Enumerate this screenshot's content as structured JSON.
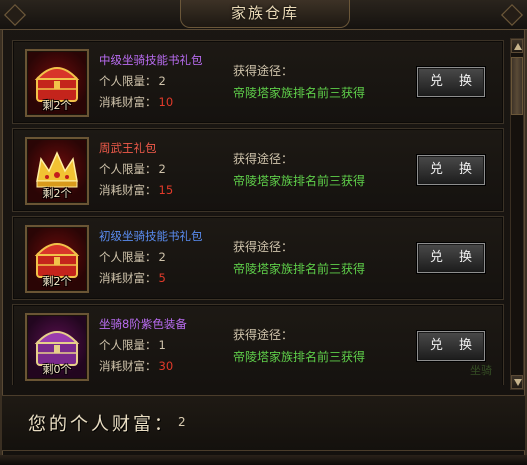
{
  "window": {
    "title": "家族仓库"
  },
  "labels": {
    "limit": "个人限量：",
    "cost": "消耗财富：",
    "source": "获得途径：",
    "exchange": "兑 换"
  },
  "items": [
    {
      "name": "中级坐骑技能书礼包",
      "name_color": "#b86cf0",
      "limit": "2",
      "cost": "10",
      "source": "帝陵塔家族排名前三获得",
      "remaining": "剩2个",
      "icon": "red-treasure-chest-icon"
    },
    {
      "name": "周武王礼包",
      "name_color": "#f05a4a",
      "limit": "2",
      "cost": "15",
      "source": "帝陵塔家族排名前三获得",
      "remaining": "剩2个",
      "icon": "golden-crown-icon"
    },
    {
      "name": "初级坐骑技能书礼包",
      "name_color": "#5a8cf0",
      "limit": "2",
      "cost": "5",
      "source": "帝陵塔家族排名前三获得",
      "remaining": "剩2个",
      "icon": "red-treasure-chest-icon"
    },
    {
      "name": "坐骑8阶紫色装备",
      "name_color": "#b86cf0",
      "limit": "1",
      "cost": "30",
      "source": "帝陵塔家族排名前三获得",
      "remaining": "剩0个",
      "icon": "purple-treasure-chest-icon"
    }
  ],
  "wealth": {
    "label": "您的个人财富：",
    "value": "2"
  },
  "watermark": "坐骑"
}
